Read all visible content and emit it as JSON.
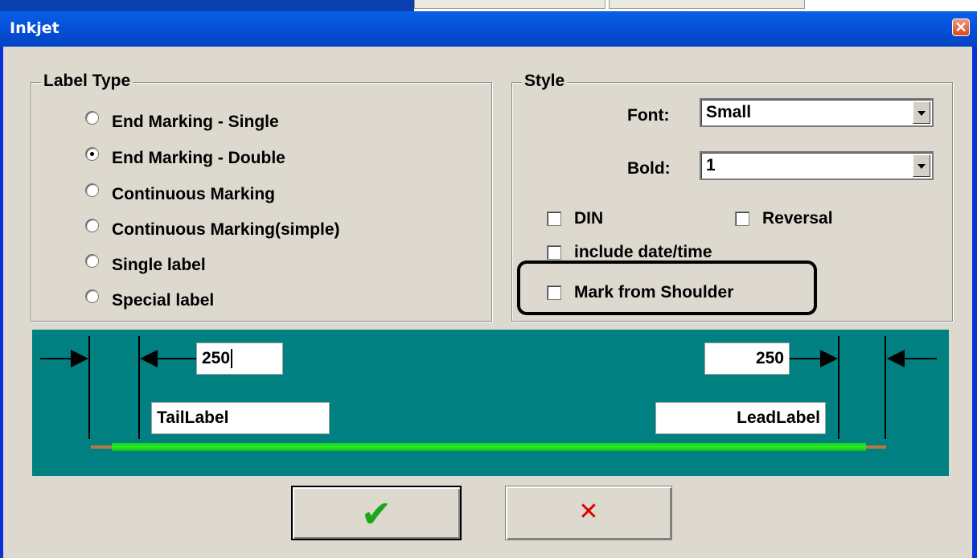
{
  "window": {
    "title": "Inkjet",
    "close_glyph": "✕"
  },
  "label_type": {
    "title": "Label Type",
    "options": [
      {
        "label": "End Marking - Single",
        "selected": false
      },
      {
        "label": "End Marking - Double",
        "selected": true
      },
      {
        "label": "Continuous Marking",
        "selected": false
      },
      {
        "label": "Continuous Marking(simple)",
        "selected": false
      },
      {
        "label": "Single label",
        "selected": false
      },
      {
        "label": "Special label",
        "selected": false
      }
    ]
  },
  "style": {
    "title": "Style",
    "font_label": "Font:",
    "font_value": "Small",
    "bold_label": "Bold:",
    "bold_value": "1",
    "checkboxes": {
      "din": "DIN",
      "reversal": "Reversal",
      "include_datetime": "include date/time",
      "mark_from_shoulder": "Mark from Shoulder"
    }
  },
  "wire_panel": {
    "tail_length": "250",
    "lead_length": "250",
    "tail_label": "TailLabel",
    "lead_label": "LeadLabel"
  },
  "buttons": {
    "ok_glyph": "✔",
    "cancel_glyph": "✕"
  },
  "colors": {
    "panel": "#008080",
    "wire": "#22e022",
    "ok": "#1aa81a",
    "cancel": "#e00000"
  }
}
